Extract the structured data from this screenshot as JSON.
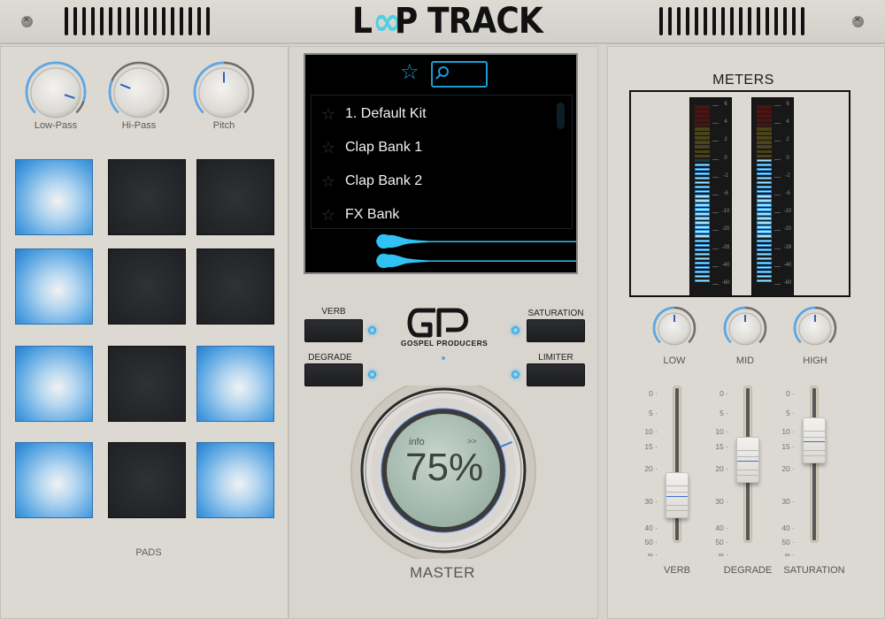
{
  "app": {
    "title_prefix": "L",
    "title_oo": "∞",
    "title_suffix": "P TRACK",
    "accent_color": "#4fd0e2",
    "highlight_color": "#1a9cd6"
  },
  "top_knobs": [
    {
      "label": "Low-Pass",
      "value": 0.9
    },
    {
      "label": "Hi-Pass",
      "value": 0.25
    },
    {
      "label": "Pitch",
      "value": 0.5
    }
  ],
  "pads": {
    "label": "PADS",
    "states": [
      true,
      false,
      false,
      true,
      false,
      false,
      true,
      false,
      true,
      true,
      false,
      true
    ]
  },
  "browser": {
    "favorites_icon": "star-icon",
    "search_icon": "search-icon",
    "search_value": "",
    "items": [
      {
        "name": "1. Default Kit",
        "favorite": false
      },
      {
        "name": "Clap Bank 1",
        "favorite": false
      },
      {
        "name": "Clap Bank 2",
        "favorite": false
      },
      {
        "name": "FX Bank",
        "favorite": false
      }
    ]
  },
  "fx_buttons": [
    {
      "label": "VERB",
      "active": true
    },
    {
      "label": "DEGRADE",
      "active": true
    },
    {
      "label": "SATURATION",
      "active": true
    },
    {
      "label": "LIMITER",
      "active": true
    }
  ],
  "brand": {
    "logo_text": "GP",
    "name": "GOSPEL PRODUCERS"
  },
  "master": {
    "label": "MASTER",
    "info_label": "info",
    "next_label": ">>",
    "value_text": "75%",
    "value": 0.75
  },
  "meters": {
    "title": "METERS",
    "scale": [
      "6",
      "4",
      "2",
      "0",
      "-2",
      "-6",
      "-10",
      "-20",
      "-28",
      "-40",
      "-60"
    ],
    "left_level_db": -0.5,
    "right_level_db": 0.2
  },
  "eq_knobs": [
    {
      "label": "LOW",
      "value": 0.5
    },
    {
      "label": "MID",
      "value": 0.5
    },
    {
      "label": "HIGH",
      "value": 0.5
    }
  ],
  "faders": {
    "scale": [
      "0",
      "5",
      "10",
      "15",
      "20",
      "30",
      "40",
      "50",
      "∞"
    ],
    "items": [
      {
        "label": "VERB",
        "value": 28
      },
      {
        "label": "DEGRADE",
        "value": 18
      },
      {
        "label": "SATURATION",
        "value": 13
      }
    ]
  }
}
